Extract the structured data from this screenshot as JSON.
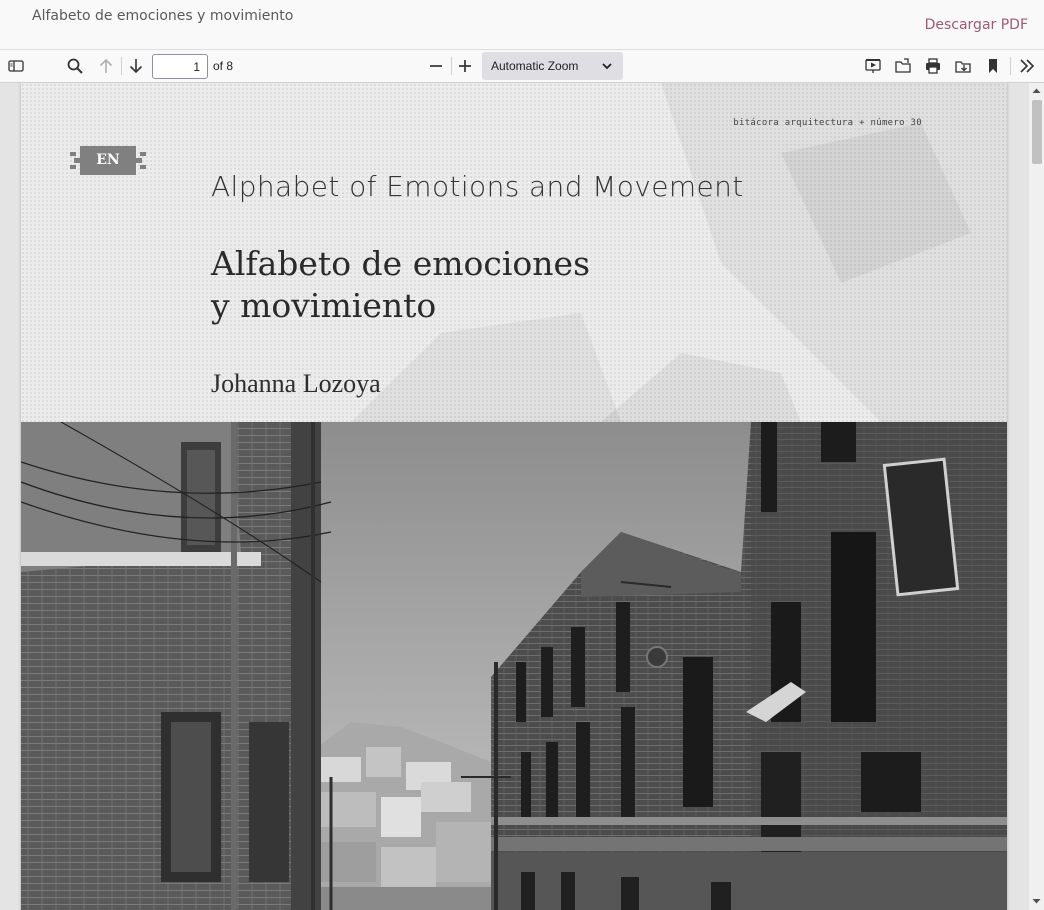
{
  "header": {
    "doc_title": "Alfabeto de emociones y movimiento",
    "download_label": "Descargar PDF",
    "download_color": "#a05878"
  },
  "toolbar": {
    "sidebar_toggle_icon": "sidebar-toggle-icon",
    "search_icon": "search-icon",
    "prev_page_icon": "arrow-up-icon",
    "next_page_icon": "arrow-down-icon",
    "page_number": "1",
    "page_count_label": "of 8",
    "zoom_out_icon": "minus-icon",
    "zoom_in_icon": "plus-icon",
    "zoom_value": "Automatic Zoom",
    "presentation_icon": "presentation-mode-icon",
    "open_file_icon": "open-file-icon",
    "print_icon": "print-icon",
    "save_icon": "download-icon",
    "bookmark_icon": "bookmark-icon",
    "tools_icon": "double-chevron-right-icon"
  },
  "page": {
    "journal_line": "bitácora arquitectura + número 30",
    "language_badge": "EN",
    "title_en": "Alphabet of Emotions and Movement",
    "title_es_line1": "Alfabeto de emociones",
    "title_es_line2": "y movimiento",
    "author": "Johanna Lozoya",
    "photo_description_icon": "street-photo-image"
  }
}
